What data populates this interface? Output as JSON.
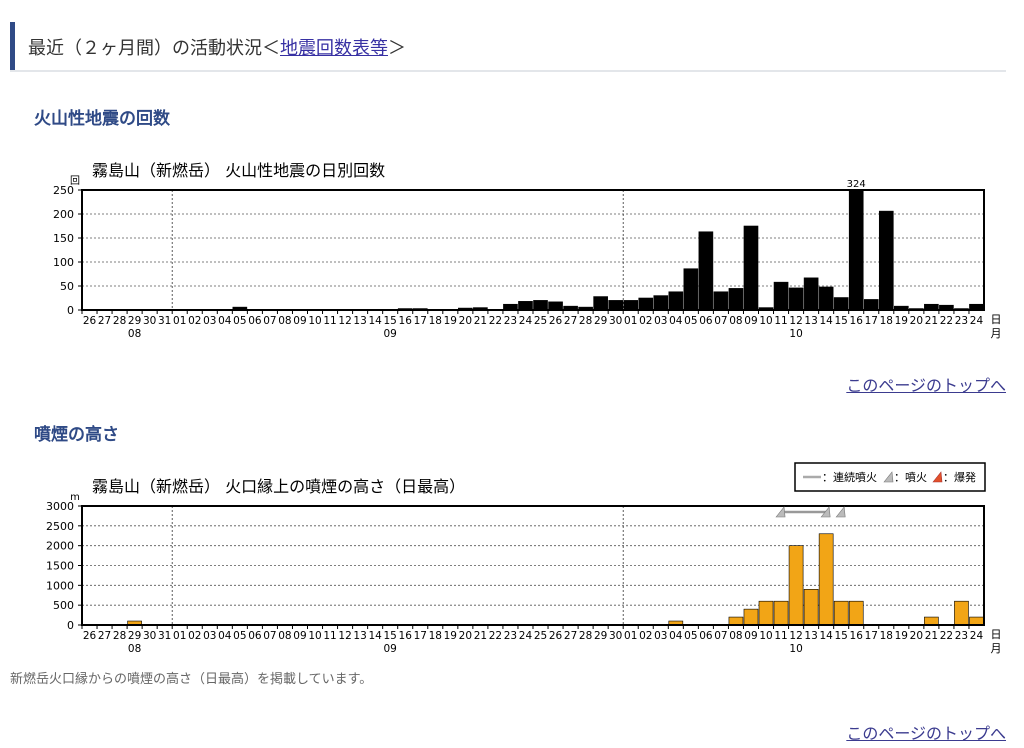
{
  "section": {
    "title_prefix": "最近（２ヶ月間）の活動状況＜",
    "title_link": "地震回数表等",
    "title_suffix": "＞"
  },
  "quake_heading": "火山性地震の回数",
  "plume_heading": "噴煙の高さ",
  "top_link": "このページのトップへ",
  "note": "新燃岳火口縁からの噴煙の高さ（日最高）を掲載しています。",
  "legend": {
    "continuous": "：連続噴火",
    "eruption": "：噴火",
    "explosion": "：爆発"
  },
  "axis_common": {
    "day_labels": [
      "26",
      "27",
      "28",
      "29",
      "30",
      "31",
      "01",
      "02",
      "03",
      "04",
      "05",
      "06",
      "07",
      "08",
      "09",
      "10",
      "11",
      "12",
      "13",
      "14",
      "15",
      "16",
      "17",
      "18",
      "19",
      "20",
      "21",
      "22",
      "23",
      "24",
      "25",
      "26",
      "27",
      "28",
      "29",
      "30",
      "01",
      "02",
      "03",
      "04",
      "05",
      "06",
      "07",
      "08",
      "09",
      "10",
      "11",
      "12",
      "13",
      "14",
      "15",
      "16",
      "17",
      "18",
      "19",
      "20",
      "21",
      "22",
      "23",
      "24"
    ],
    "month_labels": [
      {
        "label": "08",
        "index": 3
      },
      {
        "label": "09",
        "index": 20
      },
      {
        "label": "10",
        "index": 47
      }
    ],
    "month_dividers": [
      6,
      36
    ],
    "unit_day": "日",
    "unit_month": "月"
  },
  "chart_data": [
    {
      "type": "bar",
      "title": "霧島山（新燃岳） 火山性地震の日別回数",
      "ylabel": "回",
      "ylim": [
        0,
        250
      ],
      "yticks": [
        "0",
        "50",
        "100",
        "150",
        "200",
        "250"
      ],
      "color": "#000000",
      "overflow_label": {
        "index": 51,
        "text": "324"
      },
      "values": [
        0,
        0,
        0,
        0,
        0,
        0,
        0,
        0,
        0,
        0,
        6,
        1,
        1,
        1,
        1,
        1,
        1,
        1,
        1,
        1,
        1,
        3,
        3,
        1,
        1,
        4,
        5,
        1,
        12,
        18,
        20,
        17,
        8,
        6,
        28,
        20,
        20,
        25,
        30,
        38,
        86,
        163,
        38,
        45,
        175,
        5,
        58,
        46,
        67,
        48,
        26,
        324,
        22,
        206,
        8,
        3,
        12,
        10,
        3,
        12
      ]
    },
    {
      "type": "bar",
      "title": "霧島山（新燃岳） 火口縁上の噴煙の高さ（日最高）",
      "ylabel": "m",
      "ylim": [
        0,
        3000
      ],
      "yticks": [
        "0",
        "500",
        "1000",
        "1500",
        "2000",
        "2500",
        "3000"
      ],
      "color": "#f2a516",
      "values": [
        0,
        0,
        0,
        100,
        0,
        0,
        0,
        0,
        0,
        0,
        0,
        0,
        0,
        0,
        0,
        0,
        0,
        0,
        0,
        0,
        0,
        0,
        0,
        0,
        0,
        0,
        0,
        0,
        0,
        0,
        0,
        0,
        0,
        0,
        0,
        0,
        0,
        0,
        0,
        100,
        0,
        0,
        0,
        200,
        400,
        600,
        600,
        2000,
        900,
        2300,
        600,
        600,
        0,
        0,
        0,
        0,
        200,
        0,
        600,
        200
      ],
      "events": {
        "continuous": {
          "from": 46,
          "to": 49
        },
        "eruption": [
          46,
          49,
          50
        ],
        "explosion": [
          50
        ]
      }
    }
  ]
}
